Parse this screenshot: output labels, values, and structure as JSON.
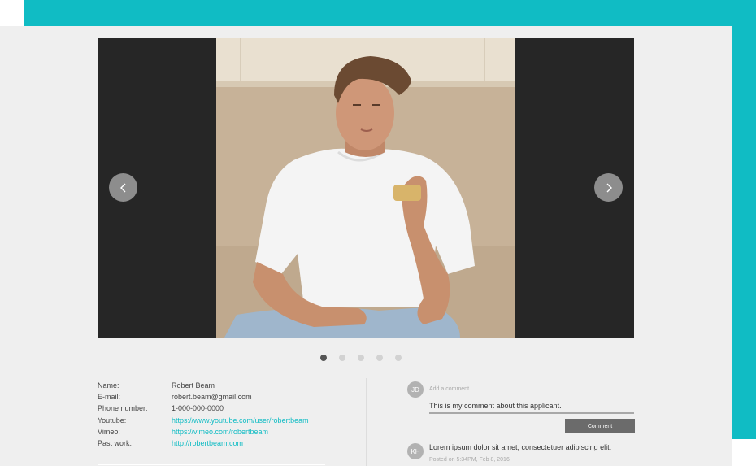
{
  "gallery": {
    "prev_icon": "chevron-left-icon",
    "next_icon": "chevron-right-icon",
    "slide_count": 5,
    "active_slide": 1
  },
  "profile": {
    "fields": [
      {
        "label": "Name:",
        "value": "Robert Beam",
        "is_link": false
      },
      {
        "label": "E-mail:",
        "value": "robert.beam@gmail.com",
        "is_link": false
      },
      {
        "label": "Phone number:",
        "value": "1-000-000-0000",
        "is_link": false
      },
      {
        "label": "Youtube:",
        "value": "https://www.youtube.com/user/robertbeam",
        "is_link": true
      },
      {
        "label": "Vimeo:",
        "value": "https://vimeo.com/robertbeam",
        "is_link": true
      },
      {
        "label": "Past work:",
        "value": "http://robertbeam.com",
        "is_link": true
      }
    ]
  },
  "comments": {
    "current_user_initials": "JD",
    "input_placeholder": "Add a comment",
    "input_value": "This is my comment about this applicant.",
    "submit_label": "Comment",
    "items": [
      {
        "initials": "KH",
        "text": "Lorem ipsum dolor sit amet, consectetuer adipiscing elit.",
        "meta": "Posted on 5:34PM, Feb 8, 2016"
      }
    ]
  },
  "colors": {
    "accent": "#10bcc4",
    "panel_bg": "#efefef",
    "slider_bg": "#262626"
  }
}
